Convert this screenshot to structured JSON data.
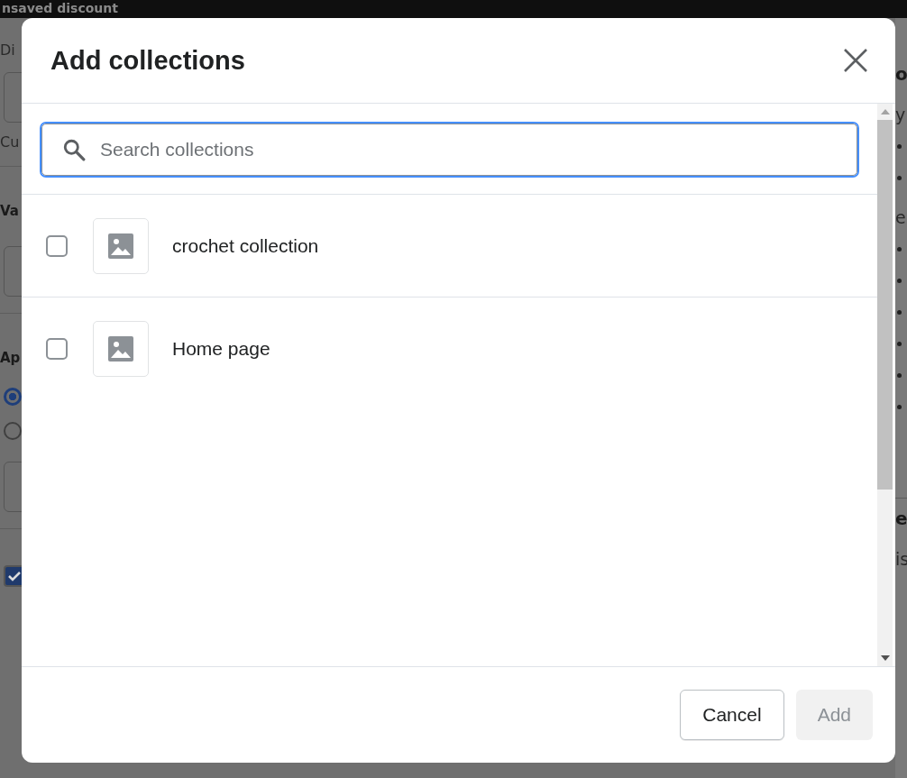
{
  "background": {
    "top_bar": {
      "title": "nsaved discount"
    },
    "left": [
      {
        "kind": "label",
        "text": "Di"
      },
      {
        "kind": "input"
      },
      {
        "kind": "label",
        "text": "Cu"
      },
      {
        "kind": "divider"
      },
      {
        "kind": "heading",
        "text": "Va"
      },
      {
        "kind": "input"
      },
      {
        "kind": "divider"
      },
      {
        "kind": "heading",
        "text": "Ap"
      },
      {
        "kind": "radio",
        "selected": true
      },
      {
        "kind": "radio",
        "selected": false
      },
      {
        "kind": "input"
      },
      {
        "kind": "divider"
      },
      {
        "kind": "checkbox",
        "checked": true
      }
    ],
    "right": [
      {
        "kind": "heading",
        "text": "o"
      },
      {
        "kind": "label",
        "text": "y"
      },
      {
        "kind": "bullet"
      },
      {
        "kind": "bullet"
      },
      {
        "kind": "label",
        "text": "e"
      },
      {
        "kind": "bullet"
      },
      {
        "kind": "bullet"
      },
      {
        "kind": "bullet"
      },
      {
        "kind": "bullet"
      },
      {
        "kind": "bullet"
      },
      {
        "kind": "bullet"
      },
      {
        "kind": "divider"
      },
      {
        "kind": "heading",
        "text": "e"
      },
      {
        "kind": "label",
        "text": "is"
      }
    ]
  },
  "dialog": {
    "title": "Add collections",
    "search": {
      "placeholder": "Search collections",
      "focused": true
    },
    "items": [
      {
        "label": "crochet collection",
        "checked": false
      },
      {
        "label": "Home page",
        "checked": false
      }
    ],
    "buttons": [
      {
        "label": "Cancel",
        "kind": "secondary",
        "disabled": false
      },
      {
        "label": "Add",
        "kind": "primary",
        "disabled": true
      }
    ]
  }
}
